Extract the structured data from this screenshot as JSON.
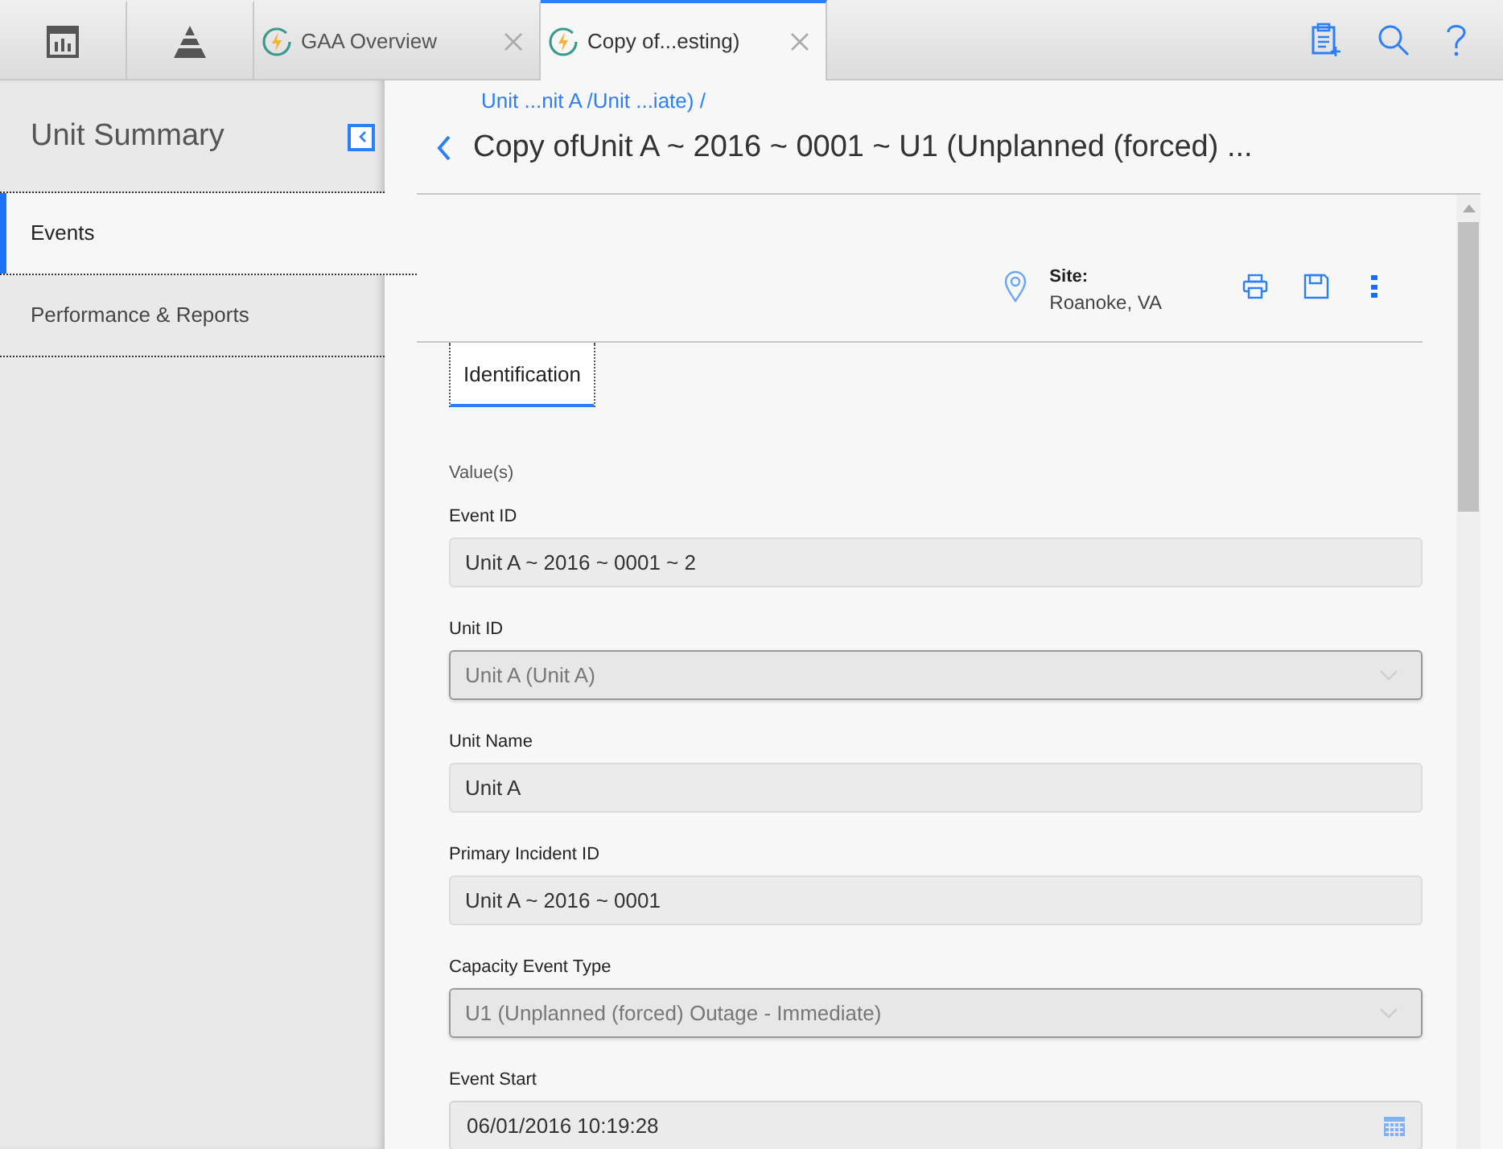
{
  "top_tabs": [
    {
      "kind": "icon",
      "selected": false
    },
    {
      "kind": "icon",
      "selected": false
    },
    {
      "kind": "doc",
      "label": "GAA Overview",
      "selected": false
    },
    {
      "kind": "doc",
      "label": "Copy of...esting)",
      "selected": true
    }
  ],
  "sidebar": {
    "title": "Unit Summary",
    "items": [
      {
        "label": "Events",
        "selected": true
      },
      {
        "label": "Performance & Reports",
        "selected": false
      }
    ]
  },
  "breadcrumb": "Unit ...nit A /Unit ...iate) /",
  "title": "Copy ofUnit A ~ 2016 ~ 0001 ~ U1 (Unplanned (forced) ...",
  "site": {
    "label": "Site:",
    "value": "Roanoke, VA"
  },
  "form_tabs": [
    {
      "label": "Identification",
      "selected": true
    }
  ],
  "section_label": "Value(s)",
  "fields": [
    {
      "kind": "text",
      "label": "Event ID",
      "value": "Unit A ~ 2016 ~ 0001 ~ 2"
    },
    {
      "kind": "select",
      "label": "Unit ID",
      "value": "Unit A (Unit A)"
    },
    {
      "kind": "text",
      "label": "Unit Name",
      "value": "Unit A"
    },
    {
      "kind": "text",
      "label": "Primary Incident ID",
      "value": "Unit A ~ 2016 ~ 0001"
    },
    {
      "kind": "select",
      "label": "Capacity Event Type",
      "value": "U1 (Unplanned (forced) Outage - Immediate)"
    },
    {
      "kind": "date",
      "label": "Event Start",
      "value": "06/01/2016 10:19:28"
    }
  ]
}
